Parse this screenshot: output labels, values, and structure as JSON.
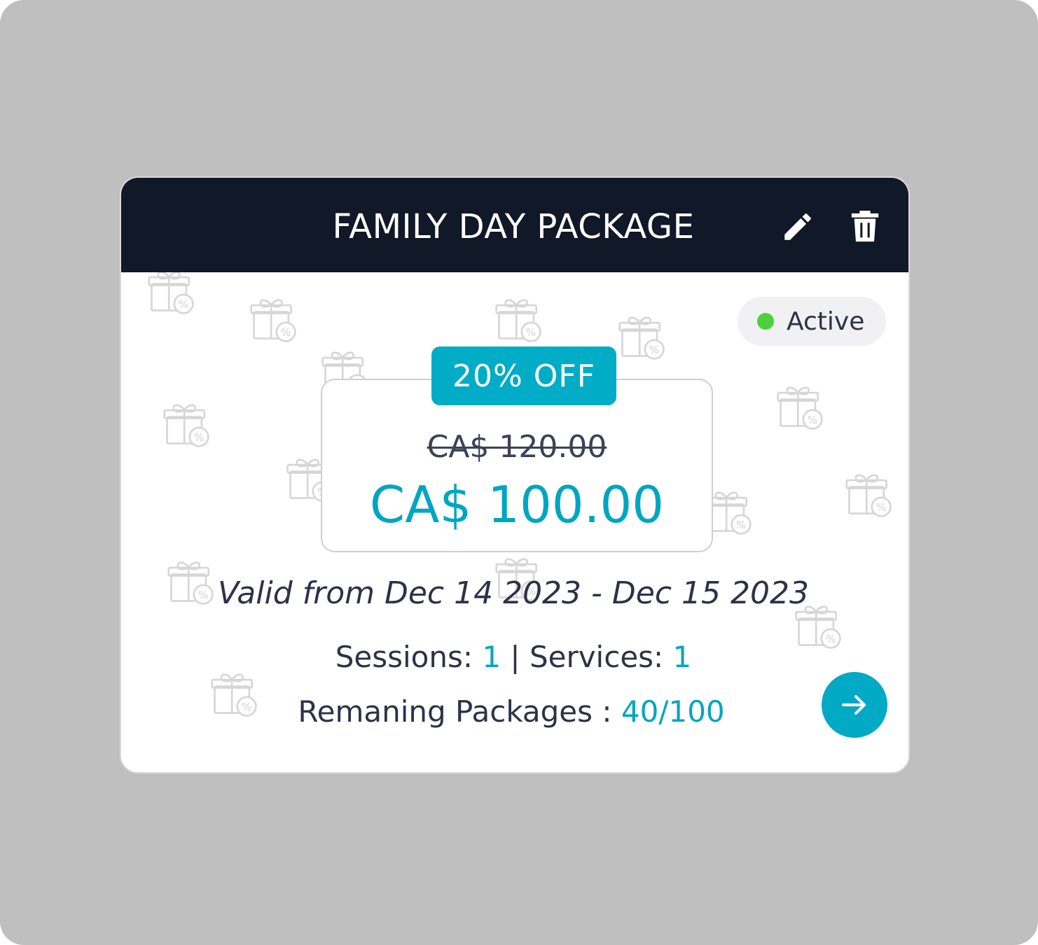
{
  "package": {
    "title": "FAMILY DAY PACKAGE",
    "status": "Active",
    "discount": "20% OFF",
    "original_price": "CA$ 120.00",
    "price": "CA$ 100.00",
    "validity": "Valid from Dec 14 2023 - Dec 15 2023",
    "sessions_label": "Sessions: ",
    "sessions_value": "1",
    "separator": " | ",
    "services_label": "Services: ",
    "services_value": "1",
    "remaining_label": "Remaning Packages : ",
    "remaining_value": "40/100"
  },
  "icons": {
    "edit": "pencil-icon",
    "delete": "trash-icon",
    "go": "arrow-right-icon",
    "background": "gift-icon"
  },
  "colors": {
    "header": "#111827",
    "accent": "#00a6bf",
    "status_dot": "#4cd13d",
    "frame": "#bfbfbf"
  }
}
